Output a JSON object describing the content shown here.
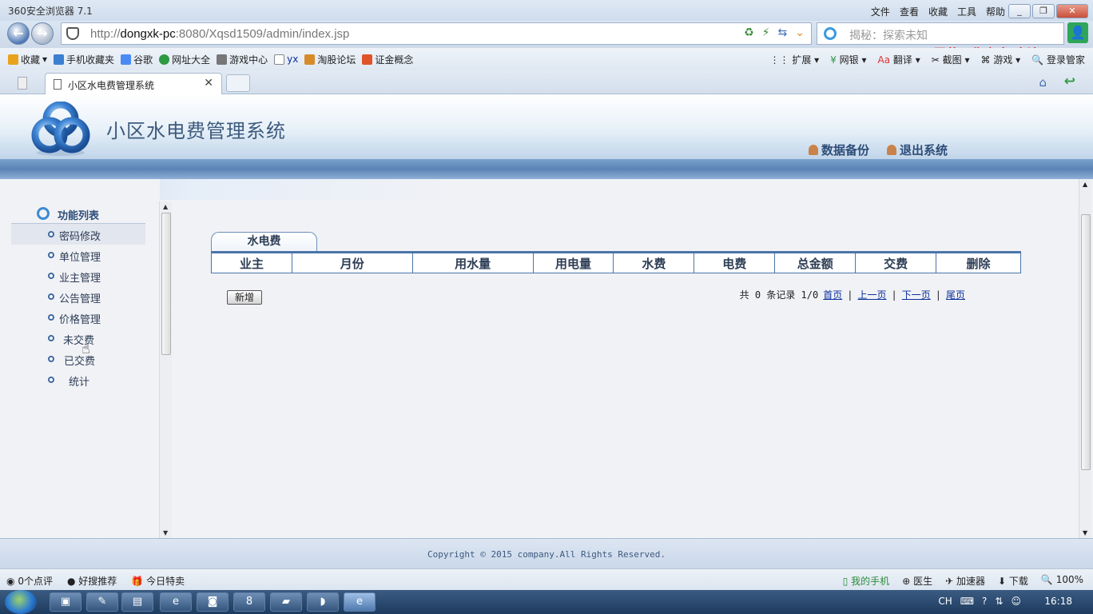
{
  "browser": {
    "title": "360安全浏览器 7.1",
    "menu": [
      "文件",
      "查看",
      "收藏",
      "工具",
      "帮助"
    ],
    "url_prefix": "http://",
    "url_host": "dongxk-pc",
    "url_rest": ":8080/Xqsd1509/admin/index.jsp",
    "search_placeholder": "揭秘：探索未知",
    "watermark": "屏幕录像专家 未注册",
    "bookmarks": [
      {
        "label": "收藏",
        "icon": "star-icon",
        "color": "#e8a21c"
      },
      {
        "label": "手机收藏夹",
        "icon": "phone-icon",
        "color": "#3b7fd0"
      },
      {
        "label": "谷歌",
        "icon": "google-icon",
        "color": "#4a8af4"
      },
      {
        "label": "网址大全",
        "icon": "web-icon",
        "color": "#2e9a42"
      },
      {
        "label": "游戏中心",
        "icon": "gamepad-icon",
        "color": "#777777"
      },
      {
        "label": "yx",
        "icon": "page-icon",
        "color": "#dddddd"
      },
      {
        "label": "淘股论坛",
        "icon": "forum-icon",
        "color": "#d88b2a"
      },
      {
        "label": "证金概念",
        "icon": "stock-icon",
        "color": "#e0542a"
      }
    ],
    "bookmarks_right": [
      "扩展",
      "网银",
      "翻译",
      "截图",
      "游戏",
      "登录管家"
    ],
    "tab_title": "小区水电费管理系统"
  },
  "header": {
    "system_title": "小区水电费管理系统",
    "backup_link": "数据备份",
    "logout_link": "退出系统"
  },
  "sidebar": {
    "heading": "功能列表",
    "items": [
      {
        "label": "密码修改"
      },
      {
        "label": "单位管理"
      },
      {
        "label": "业主管理"
      },
      {
        "label": "公告管理"
      },
      {
        "label": "价格管理"
      },
      {
        "label": "未交费"
      },
      {
        "label": "已交费"
      },
      {
        "label": "统计"
      }
    ]
  },
  "main": {
    "tab_label": "水电费",
    "columns": [
      "业主",
      "月份",
      "用水量",
      "用电量",
      "水费",
      "电费",
      "总金额",
      "交费",
      "删除"
    ],
    "add_button": "新增",
    "pager": {
      "summary": "共 0 条记录 1/0",
      "first": "首页",
      "prev": "上一页",
      "next": "下一页",
      "last": "尾页"
    }
  },
  "footer": {
    "copyright": "Copyright © 2015 company.All Rights Reserved."
  },
  "statusbar": {
    "left": [
      "0个点评",
      "好搜推荐",
      "今日特卖"
    ],
    "right": [
      "我的手机",
      "医生",
      "加速器",
      "下载"
    ],
    "zoom": "100%"
  },
  "taskbar": {
    "lang": "CH",
    "clock": "16:18"
  }
}
